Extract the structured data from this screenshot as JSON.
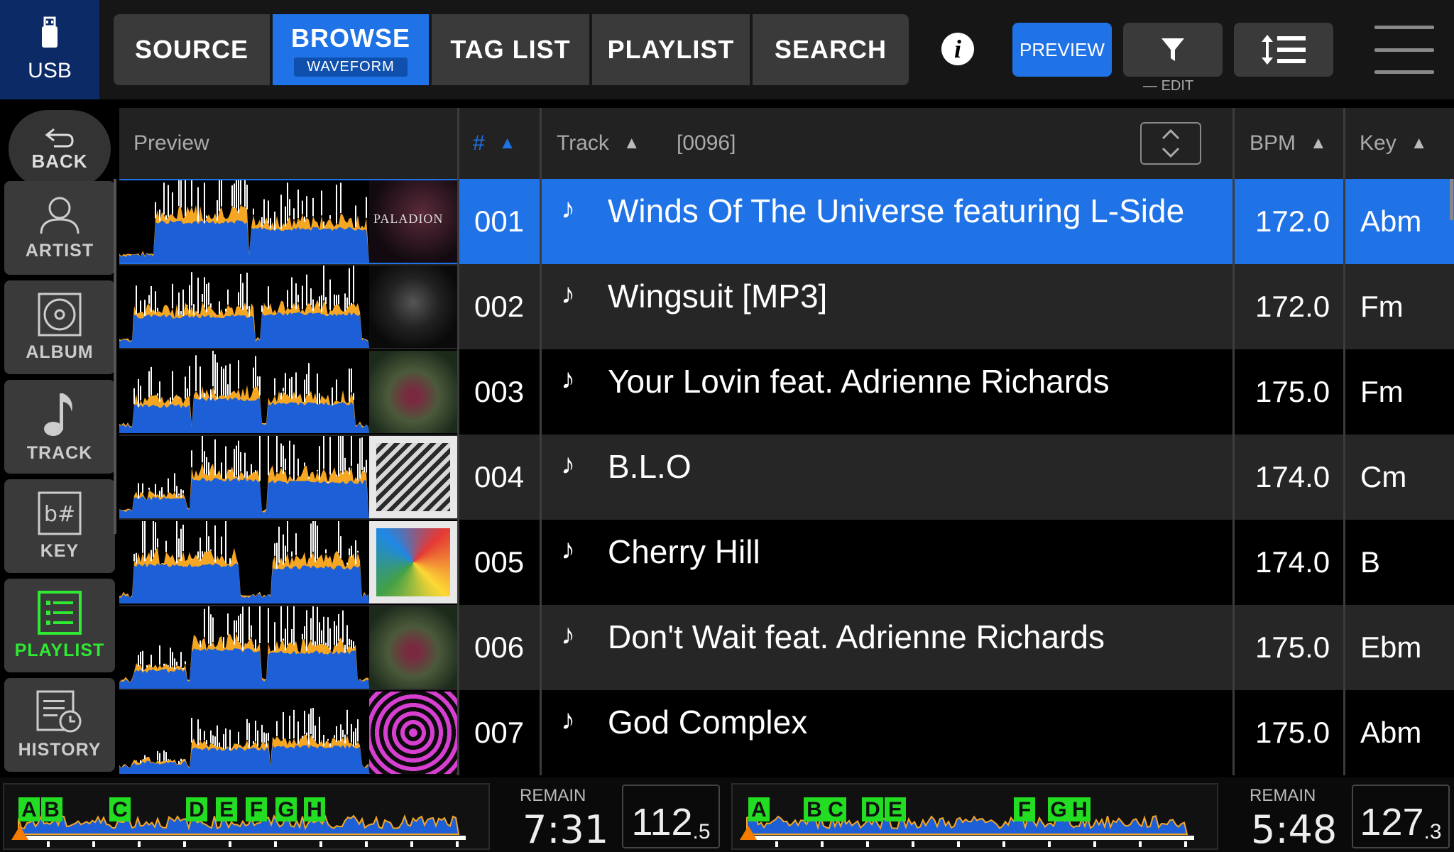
{
  "topbar": {
    "device": "USB",
    "tabs": [
      {
        "label": "SOURCE",
        "active": false
      },
      {
        "label": "BROWSE",
        "sub": "WAVEFORM",
        "active": true
      },
      {
        "label": "TAG LIST",
        "active": false
      },
      {
        "label": "PLAYLIST",
        "active": false
      },
      {
        "label": "SEARCH",
        "active": false
      }
    ],
    "info": "i",
    "preview_label": "PREVIEW",
    "edit_label": "EDIT"
  },
  "sidebar": {
    "back_label": "BACK",
    "items": [
      {
        "label": "ARTIST",
        "icon": "person-icon",
        "active": false
      },
      {
        "label": "ALBUM",
        "icon": "disc-icon",
        "active": false
      },
      {
        "label": "TRACK",
        "icon": "music-note-icon",
        "active": false
      },
      {
        "label": "KEY",
        "icon": "key-sharp-icon",
        "active": false
      },
      {
        "label": "PLAYLIST",
        "icon": "playlist-icon",
        "active": true
      },
      {
        "label": "HISTORY",
        "icon": "history-icon",
        "active": false
      }
    ]
  },
  "table": {
    "headers": {
      "preview": "Preview",
      "num": "#",
      "track": "Track",
      "count": "[0096]",
      "bpm": "BPM",
      "key": "Key"
    },
    "rows": [
      {
        "num": "001",
        "title": "Winds Of The Universe featuring L-Side",
        "bpm": "172.0",
        "key": "Abm",
        "selected": true,
        "art_text": "PALADION"
      },
      {
        "num": "002",
        "title": "Wingsuit [MP3]",
        "bpm": "172.0",
        "key": "Fm",
        "selected": false
      },
      {
        "num": "003",
        "title": "Your Lovin feat. Adrienne Richards",
        "bpm": "175.0",
        "key": "Fm",
        "selected": false
      },
      {
        "num": "004",
        "title": "B.L.O",
        "bpm": "174.0",
        "key": "Cm",
        "selected": false
      },
      {
        "num": "005",
        "title": "Cherry Hill",
        "bpm": "174.0",
        "key": "B",
        "selected": false
      },
      {
        "num": "006",
        "title": "Don't Wait feat. Adrienne Richards",
        "bpm": "175.0",
        "key": "Ebm",
        "selected": false
      },
      {
        "num": "007",
        "title": "God Complex",
        "bpm": "175.0",
        "key": "Abm",
        "selected": false
      }
    ]
  },
  "decks": [
    {
      "remain_label": "REMAIN",
      "time": "7:31",
      "bpm_int": "112",
      "bpm_dec": ".5",
      "cues": [
        "A",
        "B",
        "C",
        "D",
        "E",
        "F",
        "G",
        "H"
      ]
    },
    {
      "remain_label": "REMAIN",
      "time": "5:48",
      "bpm_int": "127",
      "bpm_dec": ".3",
      "cues": [
        "A",
        "B",
        "C",
        "D",
        "E",
        "F",
        "G",
        "H"
      ]
    }
  ],
  "colors": {
    "accent": "#1f73e6",
    "active_green": "#2eea33",
    "wave_blue": "#1c5fd6",
    "wave_orange": "#f5a623",
    "cue_green": "#22dd22"
  }
}
